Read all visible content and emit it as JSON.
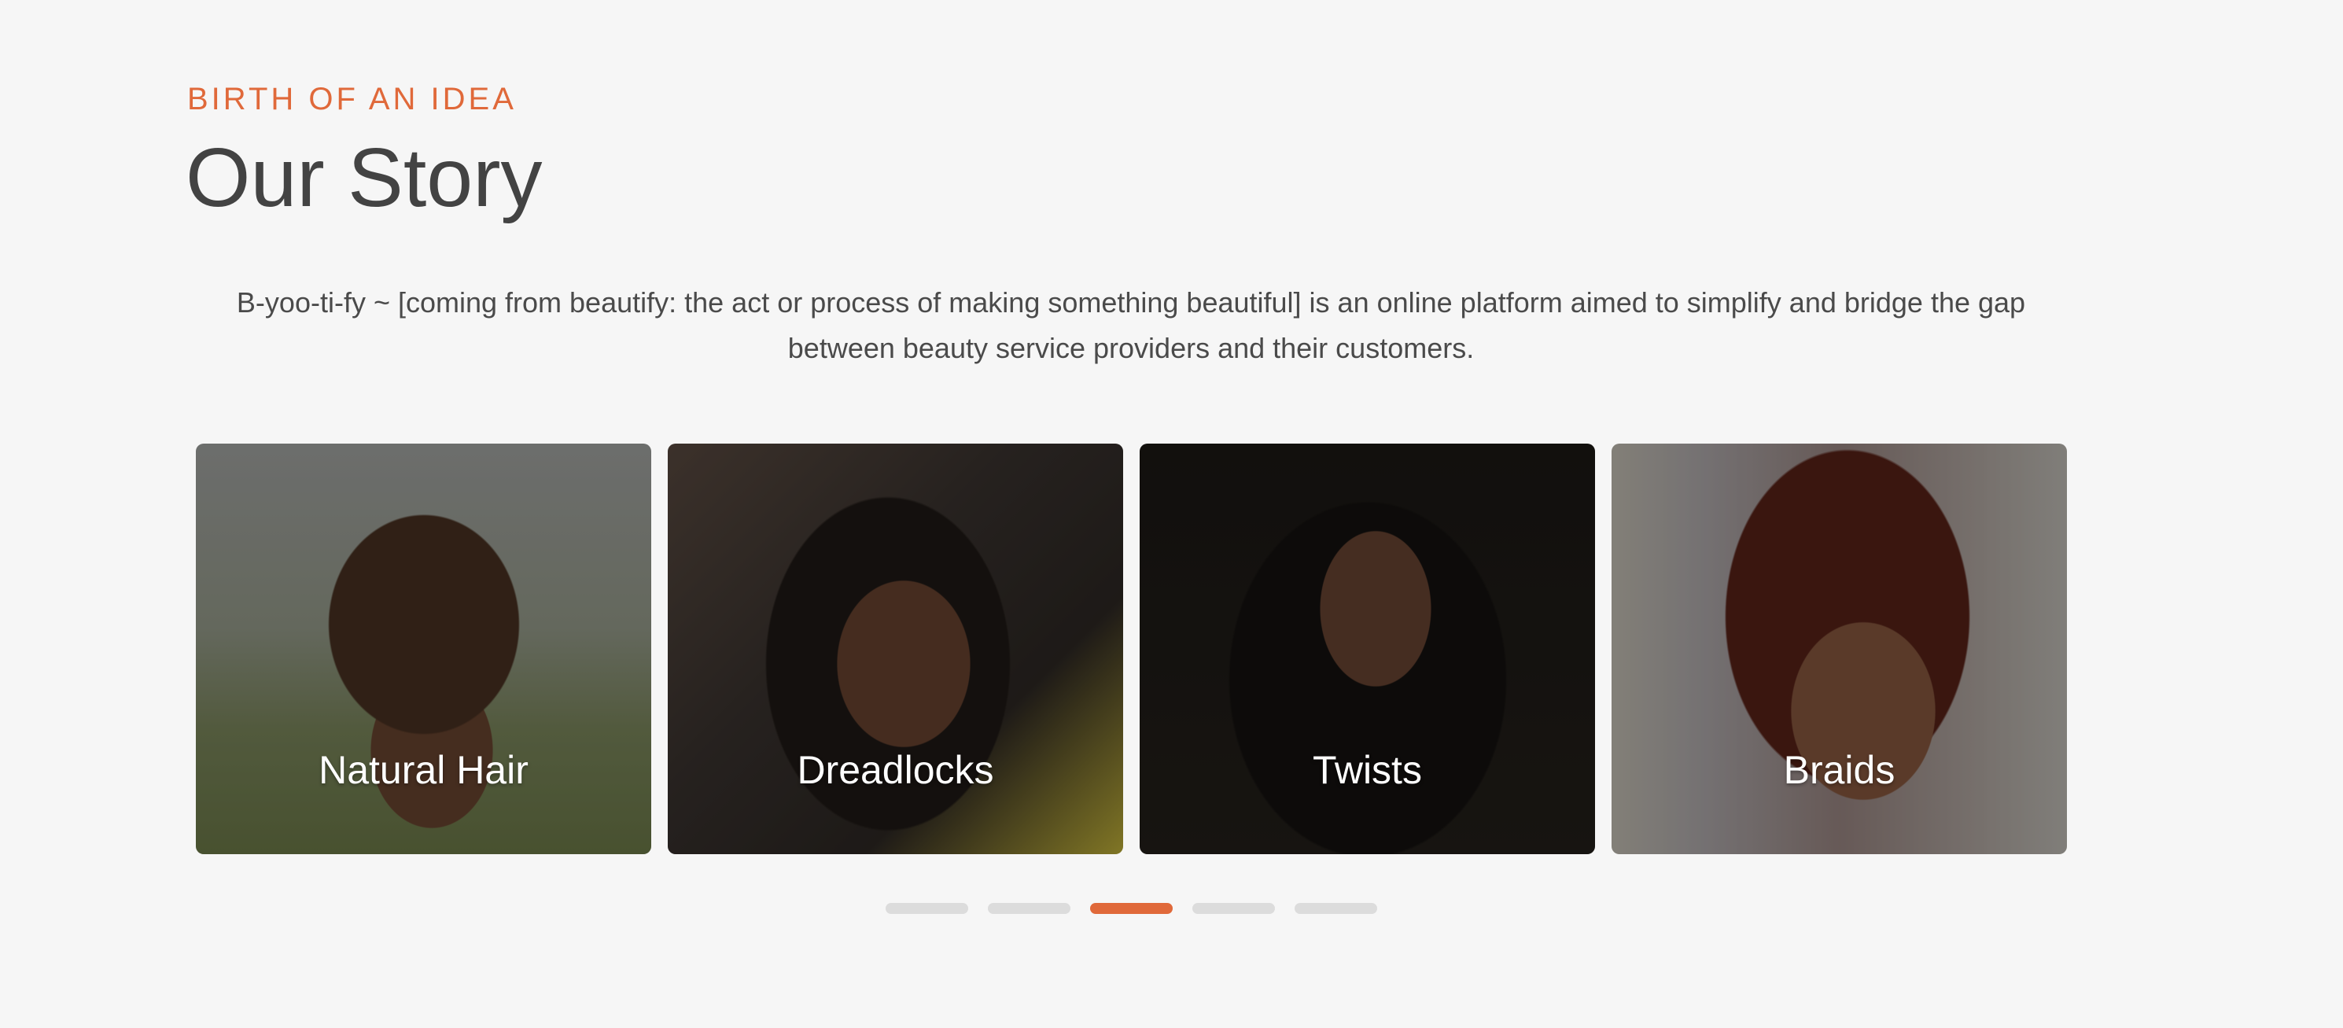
{
  "section": {
    "eyebrow": "BIRTH OF AN IDEA",
    "title": "Our Story",
    "description": "B-yoo-ti-fy ~ [coming from beautify: the act or process of making something beautiful] is an online platform aimed to simplify and bridge the gap between beauty service providers and their customers."
  },
  "cards": [
    {
      "label": "Natural Hair"
    },
    {
      "label": "Dreadlocks"
    },
    {
      "label": "Twists"
    },
    {
      "label": "Braids"
    }
  ],
  "carousel": {
    "dot_count": 5,
    "active_index": 2
  },
  "colors": {
    "accent": "#e0693a",
    "title": "#434343",
    "background": "#f6f6f6",
    "inactive_dot": "#dcdcdc"
  }
}
